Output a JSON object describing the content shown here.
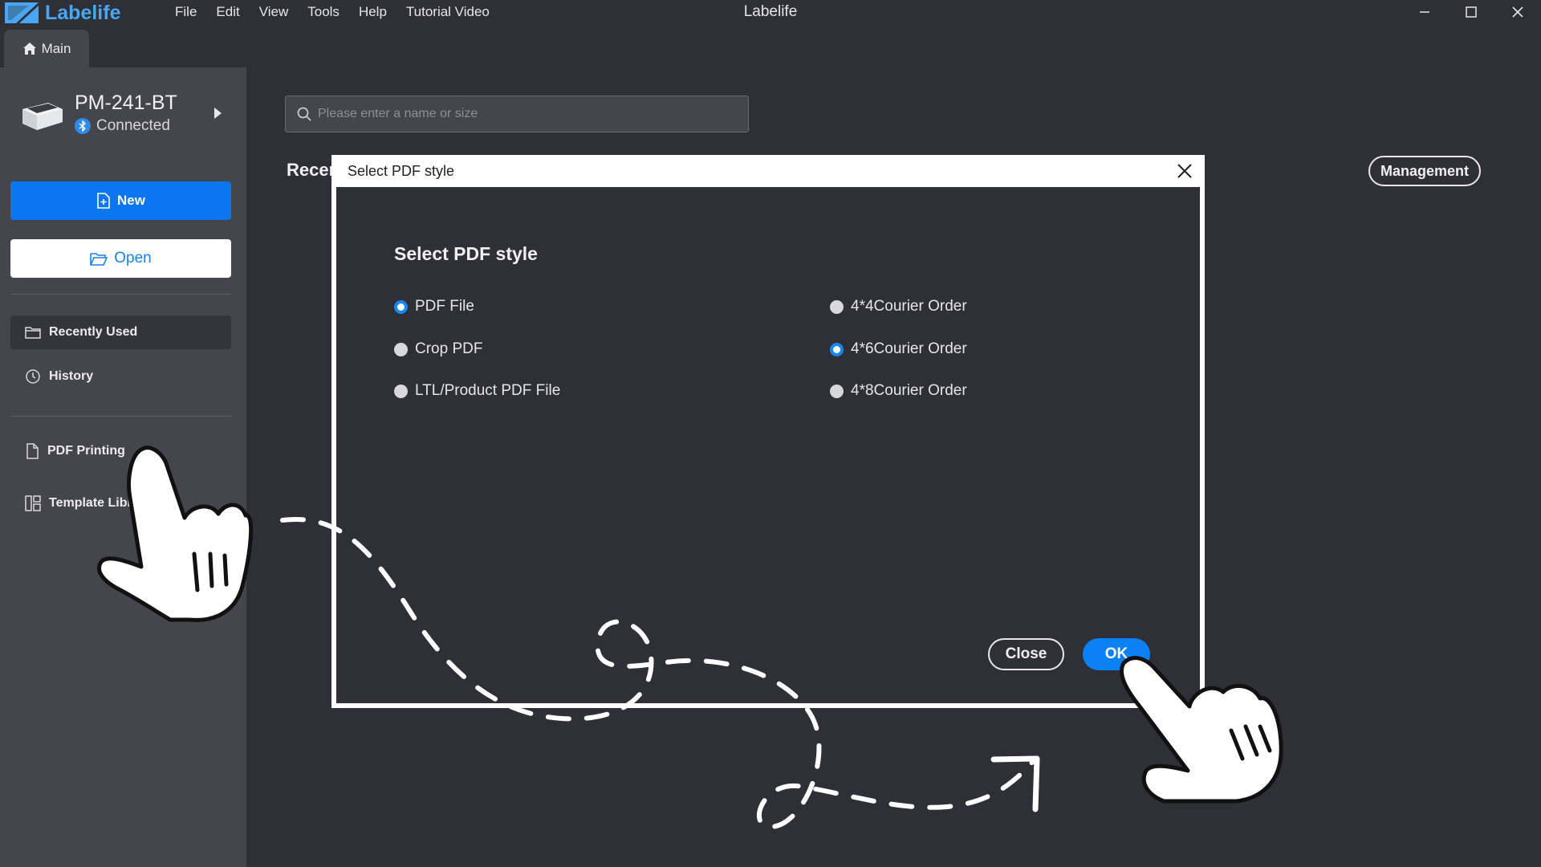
{
  "app": {
    "logo_text": "Labelife",
    "window_title": "Labelife",
    "menu": [
      "File",
      "Edit",
      "View",
      "Tools",
      "Help",
      "Tutorial Video"
    ],
    "brand_color": "#4aa6f2"
  },
  "tabs": [
    {
      "label": "Main",
      "icon": "home-icon"
    }
  ],
  "device": {
    "name": "PM-241-BT",
    "status": "Connected",
    "status_icon": "bluetooth-icon"
  },
  "sidebar": {
    "new_label": "New",
    "open_label": "Open",
    "items": [
      {
        "label": "Recently Used",
        "icon": "folder-icon",
        "active": true
      },
      {
        "label": "History",
        "icon": "clock-icon"
      },
      {
        "label": "PDF Printing",
        "icon": "document-icon"
      },
      {
        "label": "Template Libr",
        "icon": "template-icon"
      }
    ],
    "accent_color": "#0a76f0"
  },
  "main": {
    "search_placeholder": "Please enter a name or size",
    "recent_label": "Recer",
    "management_label": "Management"
  },
  "dialog": {
    "title": "Select PDF style",
    "heading": "Select PDF style",
    "left_options": [
      {
        "label": "PDF File",
        "checked": true
      },
      {
        "label": "Crop PDF",
        "checked": false
      },
      {
        "label": "LTL/Product PDF  File",
        "checked": false
      }
    ],
    "right_options": [
      {
        "label": "4*4Courier Order",
        "checked": false
      },
      {
        "label": "4*6Courier Order",
        "checked": true
      },
      {
        "label": "4*8Courier Order",
        "checked": false
      }
    ],
    "close_label": "Close",
    "ok_label": "OK",
    "ok_color": "#0a82f5"
  }
}
